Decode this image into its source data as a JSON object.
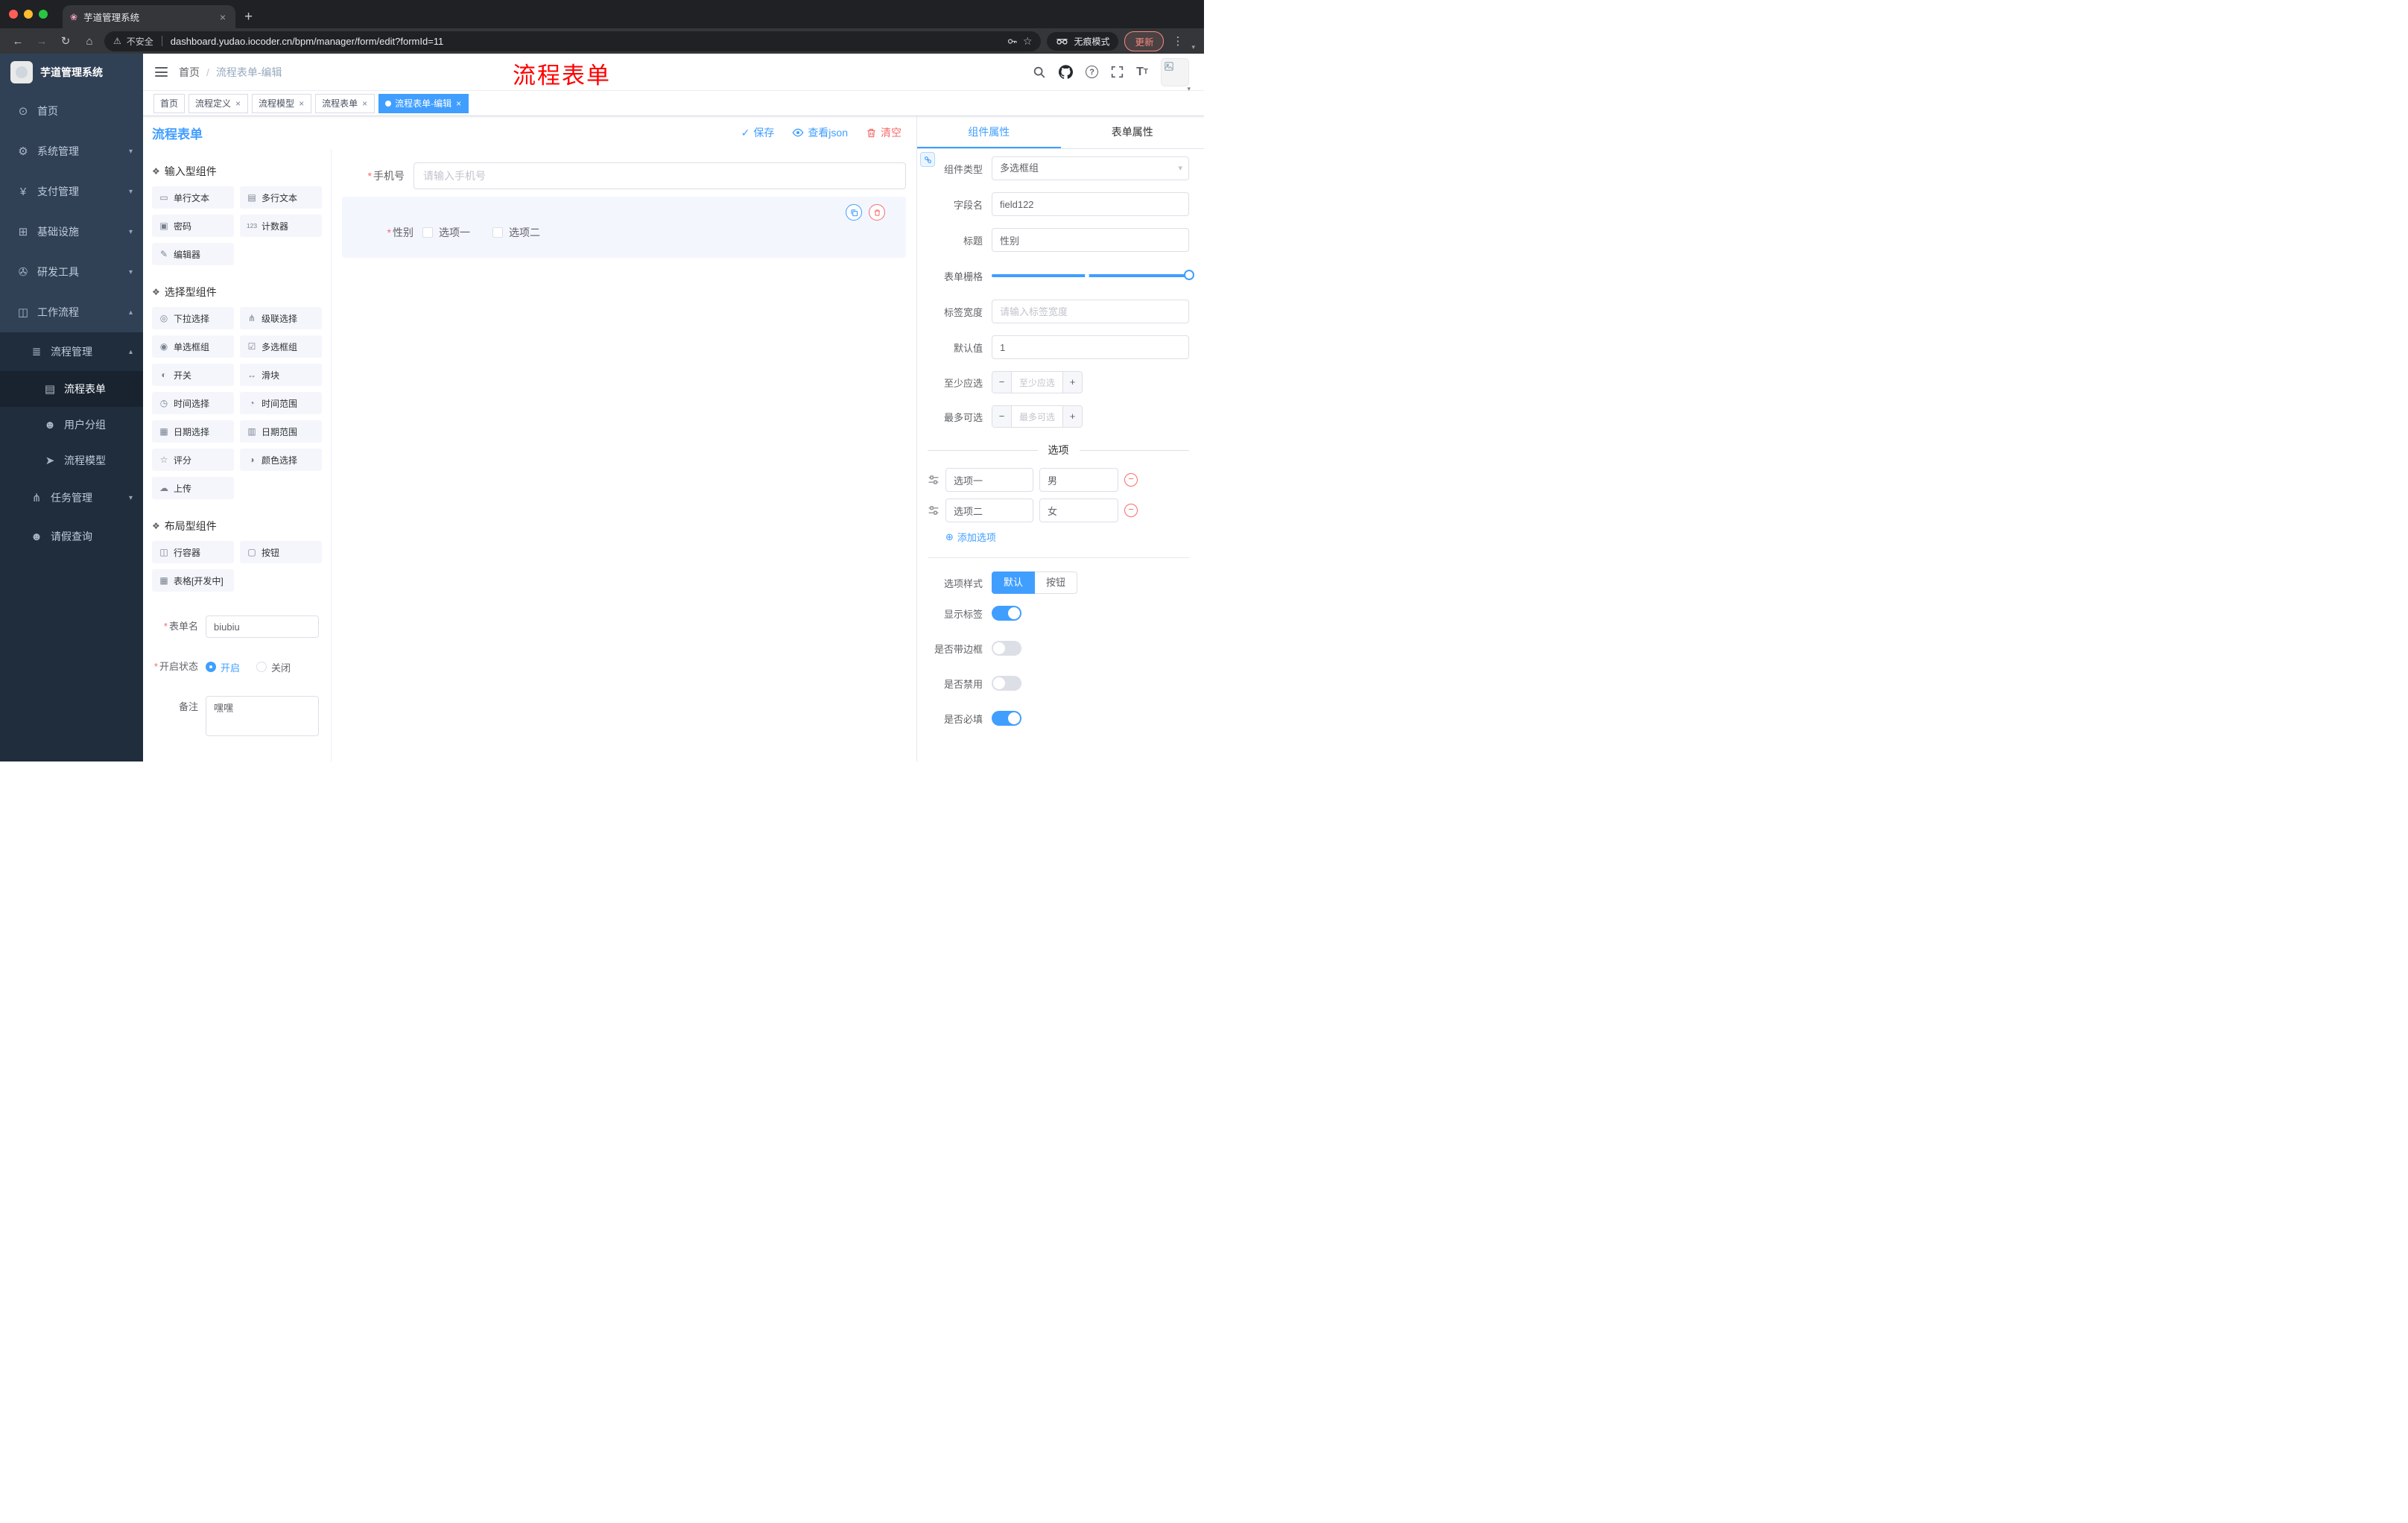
{
  "icons": {
    "close": "×",
    "plus": "+",
    "back": "←",
    "forward": "→",
    "reload": "↻",
    "home": "⌂",
    "warning": "⚠",
    "star": "☆",
    "dots": "⋮",
    "caret_down": "▾",
    "caret_up": "▴",
    "check": "✓",
    "minus": "−",
    "circle_plus": "⊕",
    "group_marker": "❖",
    "question": "?",
    "text_large": "T",
    "text_small": "T",
    "required": "*"
  },
  "chrome": {
    "tab_title": "芋道管理系统",
    "favicon_glyph": "❀",
    "url": "dashboard.yudao.iocoder.cn/bpm/manager/form/edit?formId=11",
    "security_label": "不安全",
    "incognito_label": "无痕模式",
    "update_label": "更新"
  },
  "sidebar": {
    "logo_title": "芋道管理系统",
    "items": [
      {
        "label": "首页",
        "icon": "⊙"
      },
      {
        "label": "系统管理",
        "icon": "⚙"
      },
      {
        "label": "支付管理",
        "icon": "¥"
      },
      {
        "label": "基础设施",
        "icon": "⊞"
      },
      {
        "label": "研发工具",
        "icon": "✇"
      },
      {
        "label": "工作流程",
        "icon": "◫"
      }
    ],
    "sub": {
      "process_mgmt": {
        "label": "流程管理",
        "icon": "≣"
      },
      "children": [
        {
          "label": "流程表单",
          "icon": "▤"
        },
        {
          "label": "用户分组",
          "icon": "☻"
        },
        {
          "label": "流程模型",
          "icon": "➤"
        }
      ],
      "task_mgmt": {
        "label": "任务管理",
        "icon": "⋔"
      },
      "leave_query": {
        "label": "请假查询",
        "icon": "☻"
      }
    }
  },
  "header": {
    "breadcrumb_home": "首页",
    "breadcrumb_sep": "/",
    "breadcrumb_current": "流程表单-编辑",
    "annotation": "流程表单"
  },
  "tags": [
    {
      "label": "首页"
    },
    {
      "label": "流程定义"
    },
    {
      "label": "流程模型"
    },
    {
      "label": "流程表单"
    },
    {
      "label": "流程表单-编辑"
    }
  ],
  "designer": {
    "title": "流程表单",
    "save_label": "保存",
    "view_json_label": "查看json",
    "clear_label": "清空",
    "groups": [
      {
        "title": "输入型组件",
        "items": [
          {
            "label": "单行文本",
            "icon": "▭"
          },
          {
            "label": "多行文本",
            "icon": "▤"
          },
          {
            "label": "密码",
            "icon": "▣"
          },
          {
            "label": "计数器",
            "icon": "123"
          },
          {
            "label": "编辑器",
            "icon": "✎"
          }
        ]
      },
      {
        "title": "选择型组件",
        "items": [
          {
            "label": "下拉选择",
            "icon": "◎"
          },
          {
            "label": "级联选择",
            "icon": "⋔"
          },
          {
            "label": "单选框组",
            "icon": "◉"
          },
          {
            "label": "多选框组",
            "icon": "☑"
          },
          {
            "label": "开关",
            "icon": "◐"
          },
          {
            "label": "滑块",
            "icon": "↔"
          },
          {
            "label": "时间选择",
            "icon": "◷"
          },
          {
            "label": "时间范围",
            "icon": "◔"
          },
          {
            "label": "日期选择",
            "icon": "▦"
          },
          {
            "label": "日期范围",
            "icon": "▥"
          },
          {
            "label": "评分",
            "icon": "☆"
          },
          {
            "label": "颜色选择",
            "icon": "◑"
          },
          {
            "label": "上传",
            "icon": "☁"
          }
        ]
      },
      {
        "title": "布局型组件",
        "items": [
          {
            "label": "行容器",
            "icon": "◫"
          },
          {
            "label": "按钮",
            "icon": "▢"
          },
          {
            "label": "表格[开发中]",
            "icon": "▦"
          }
        ]
      }
    ],
    "meta": {
      "form_name_label": "表单名",
      "form_name_value": "biubiu",
      "status_label": "开启状态",
      "status_on": "开启",
      "status_off": "关闭",
      "remark_label": "备注",
      "remark_value": "嘿嘿"
    },
    "canvas": {
      "phone_label": "手机号",
      "phone_placeholder": "请输入手机号",
      "gender_label": "性别",
      "gender_option1": "选项一",
      "gender_option2": "选项二"
    }
  },
  "props": {
    "tab_component": "组件属性",
    "tab_form": "表单属性",
    "rows": {
      "component_type_label": "组件类型",
      "component_type_value": "多选框组",
      "field_name_label": "字段名",
      "field_name_value": "field122",
      "title_label": "标题",
      "title_value": "性别",
      "grid_label": "表单栅格",
      "label_width_label": "标签宽度",
      "label_width_placeholder": "请输入标签宽度",
      "default_label": "默认值",
      "default_value": "1",
      "min_label": "至少应选",
      "min_placeholder": "至少应选",
      "max_label": "最多可选",
      "max_placeholder": "最多可选"
    },
    "options": {
      "divider_title": "选项",
      "rows": [
        {
          "label": "选项一",
          "value": "男"
        },
        {
          "label": "选项二",
          "value": "女"
        }
      ],
      "add_label": "添加选项"
    },
    "style": {
      "option_style_label": "选项样式",
      "style_default": "默认",
      "style_button": "按钮",
      "show_label_label": "显示标签",
      "border_label": "是否带边框",
      "disabled_label": "是否禁用",
      "required_label": "是否必填"
    }
  }
}
